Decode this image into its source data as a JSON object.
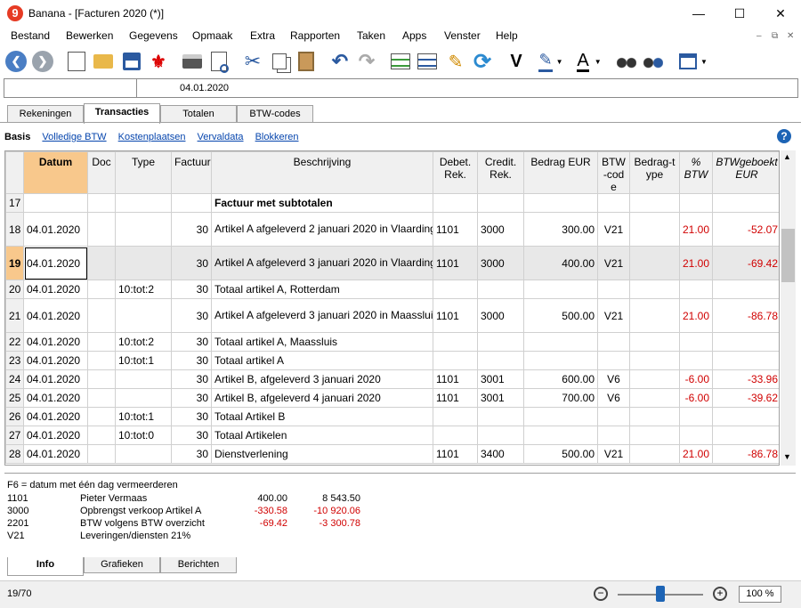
{
  "window": {
    "title": "Banana - [Facturen 2020 (*)]",
    "minimize": "—",
    "maximize": "☐",
    "close": "✕"
  },
  "menu": [
    "Bestand",
    "Bewerken",
    "Gegevens",
    "Opmaak",
    "Extra",
    "Rapporten",
    "Taken",
    "Apps",
    "Venster",
    "Help"
  ],
  "mdi": {
    "minimize": "–",
    "restore": "⧉",
    "close": "✕"
  },
  "toolbar": {
    "bold_label": "V",
    "font_color_label": "A"
  },
  "cellbar": {
    "value": "04.01.2020"
  },
  "tabs": [
    "Rekeningen",
    "Transacties",
    "Totalen",
    "BTW-codes"
  ],
  "active_tab": "Transacties",
  "views": {
    "current": "Basis",
    "links": [
      "Volledige BTW",
      "Kostenplaatsen",
      "Vervaldata",
      "Blokkeren"
    ]
  },
  "help": "?",
  "columns": [
    "Datum",
    "Doc",
    "Type",
    "Factuur",
    "Beschrijving",
    "Debet. Rek.",
    "Credit. Rek.",
    "Bedrag EUR",
    "BTW-code",
    "Bedrag-type",
    "% BTW",
    "BTWgeboekt EUR"
  ],
  "rows": [
    {
      "n": "17",
      "date": "",
      "doc": "",
      "type": "",
      "inv": "",
      "desc": "Factuur met subtotalen",
      "deb": "",
      "cred": "",
      "amt": "",
      "vat": "",
      "btype": "",
      "pct": "",
      "vatamt": "",
      "group": true
    },
    {
      "n": "18",
      "date": "04.01.2020",
      "doc": "",
      "type": "",
      "inv": "30",
      "desc": "Artikel A afgeleverd 2 januari 2020 in Vlaardingen",
      "deb": "1101",
      "cred": "3000",
      "amt": "300.00",
      "vat": "V21",
      "btype": "",
      "pct": "21.00",
      "vatamt": "-52.07"
    },
    {
      "n": "19",
      "date": "04.01.2020",
      "doc": "",
      "type": "",
      "inv": "30",
      "desc": "Artikel A afgeleverd 3 januari 2020 in Vlaardingen",
      "deb": "1101",
      "cred": "3000",
      "amt": "400.00",
      "vat": "V21",
      "btype": "",
      "pct": "21.00",
      "vatamt": "-69.42",
      "current": true
    },
    {
      "n": "20",
      "date": "04.01.2020",
      "doc": "",
      "type": "10:tot:2",
      "inv": "30",
      "desc": "Totaal artikel A, Rotterdam",
      "deb": "",
      "cred": "",
      "amt": "",
      "vat": "",
      "btype": "",
      "pct": "",
      "vatamt": ""
    },
    {
      "n": "21",
      "date": "04.01.2020",
      "doc": "",
      "type": "",
      "inv": "30",
      "desc": "Artikel A afgeleverd 3 januari 2020 in Maassluis",
      "deb": "1101",
      "cred": "3000",
      "amt": "500.00",
      "vat": "V21",
      "btype": "",
      "pct": "21.00",
      "vatamt": "-86.78"
    },
    {
      "n": "22",
      "date": "04.01.2020",
      "doc": "",
      "type": "10:tot:2",
      "inv": "30",
      "desc": "Totaal artikel A, Maassluis",
      "deb": "",
      "cred": "",
      "amt": "",
      "vat": "",
      "btype": "",
      "pct": "",
      "vatamt": ""
    },
    {
      "n": "23",
      "date": "04.01.2020",
      "doc": "",
      "type": "10:tot:1",
      "inv": "30",
      "desc": "Totaal artikel A",
      "deb": "",
      "cred": "",
      "amt": "",
      "vat": "",
      "btype": "",
      "pct": "",
      "vatamt": ""
    },
    {
      "n": "24",
      "date": "04.01.2020",
      "doc": "",
      "type": "",
      "inv": "30",
      "desc": "Artikel B, afgeleverd 3 januari 2020",
      "deb": "1101",
      "cred": "3001",
      "amt": "600.00",
      "vat": "V6",
      "btype": "",
      "pct": "-6.00",
      "vatamt": "-33.96"
    },
    {
      "n": "25",
      "date": "04.01.2020",
      "doc": "",
      "type": "",
      "inv": "30",
      "desc": "Artikel B, afgeleverd 4 januari 2020",
      "deb": "1101",
      "cred": "3001",
      "amt": "700.00",
      "vat": "V6",
      "btype": "",
      "pct": "-6.00",
      "vatamt": "-39.62"
    },
    {
      "n": "26",
      "date": "04.01.2020",
      "doc": "",
      "type": "10:tot:1",
      "inv": "30",
      "desc": "Totaal Artikel B",
      "deb": "",
      "cred": "",
      "amt": "",
      "vat": "",
      "btype": "",
      "pct": "",
      "vatamt": ""
    },
    {
      "n": "27",
      "date": "04.01.2020",
      "doc": "",
      "type": "10:tot:0",
      "inv": "30",
      "desc": "Totaal Artikelen",
      "deb": "",
      "cred": "",
      "amt": "",
      "vat": "",
      "btype": "",
      "pct": "",
      "vatamt": ""
    },
    {
      "n": "28",
      "date": "04.01.2020",
      "doc": "",
      "type": "",
      "inv": "30",
      "desc": "Dienstverlening",
      "deb": "1101",
      "cred": "3400",
      "amt": "500.00",
      "vat": "V21",
      "btype": "",
      "pct": "21.00",
      "vatamt": "-86.78"
    }
  ],
  "info": {
    "hint": "F6 = datum met één dag vermeerderen",
    "lines": [
      {
        "code": "1101",
        "name": "Pieter Vermaas",
        "amt": "400.00",
        "bal": "8 543.50",
        "red": false
      },
      {
        "code": "3000",
        "name": "Opbrengst verkoop Artikel A",
        "amt": "-330.58",
        "bal": "-10 920.06",
        "red": true
      },
      {
        "code": "2201",
        "name": "BTW volgens BTW overzicht",
        "amt": "-69.42",
        "bal": "-3 300.78",
        "red": true
      },
      {
        "code": "V21",
        "name": "Leveringen/diensten 21%",
        "amt": "",
        "bal": "",
        "red": false
      }
    ]
  },
  "bottom_tabs": [
    "Info",
    "Grafieken",
    "Berichten"
  ],
  "status": {
    "position": "19/70",
    "zoom": "100 %"
  },
  "colors": {
    "accent": "#1d64b5",
    "selected_header": "#f8c88c",
    "negative": "#d00000"
  }
}
